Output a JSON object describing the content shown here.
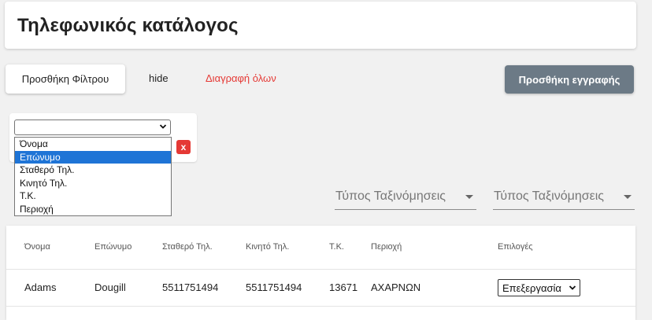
{
  "header": {
    "title": "Τηλεφωνικός κατάλογος"
  },
  "toolbar": {
    "add_filter_label": "Προσθήκη Φίλτρου",
    "hide_label": "hide",
    "delete_all_label": "Διαγραφή όλων",
    "add_entry_label": "Προσθήκη εγγραφής"
  },
  "filter": {
    "selected_value": "",
    "remove_label": "x",
    "options": [
      "Όνομα",
      "Επώνυμο",
      "Σταθερό Τηλ.",
      "Κινητό Τηλ.",
      "Τ.Κ.",
      "Περιοχή"
    ],
    "highlighted_option": "Επώνυμο"
  },
  "sort": [
    {
      "label": "Τύπος Ταξινόμησεις"
    },
    {
      "label": "Τύπος Ταξινόμησεις"
    }
  ],
  "table": {
    "headers": [
      "Όνομα",
      "Επώνυμο",
      "Σταθερό Τηλ.",
      "Κινητό Τηλ.",
      "Τ.Κ.",
      "Περιοχή",
      "Επιλογές"
    ],
    "rows": [
      {
        "first_name": "Adams",
        "last_name": "Dougill",
        "landline": "5511751494",
        "mobile": "5511751494",
        "postal_code": "13671",
        "area": "ΑΧΑΡΝΩΝ",
        "options_value": "Επεξεργασία"
      }
    ]
  },
  "colors": {
    "accent_button": "#6c7a86",
    "danger": "#e53935",
    "selection": "#1e74d6"
  },
  "icons": {
    "select_caret": "chevron-down-icon",
    "sort_caret": "caret-down-icon",
    "remove": "close-icon"
  }
}
